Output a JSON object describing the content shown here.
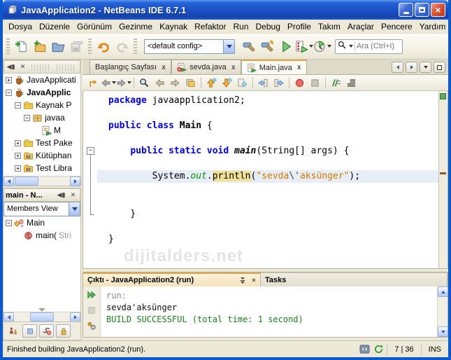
{
  "window": {
    "title": "JavaApplication2 - NetBeans IDE 6.7.1"
  },
  "menu_bar": {
    "items": [
      "Dosya",
      "Düzenle",
      "Görünüm",
      "Gezinme",
      "Kaynak",
      "Refaktor",
      "Run",
      "Debug",
      "Profile",
      "Takım",
      "Araçlar",
      "Pencere",
      "Yardım"
    ]
  },
  "toolbar": {
    "config_value": "<default config>",
    "search_placeholder": "Ara (Ctrl+I)",
    "group1": [
      {
        "icon": "new-file"
      },
      {
        "icon": "new-project"
      },
      {
        "icon": "open-project"
      },
      {
        "icon": "save-all",
        "disabled": true
      }
    ],
    "group2": [
      {
        "icon": "undo"
      },
      {
        "icon": "redo",
        "disabled": true
      }
    ],
    "group3": [
      {
        "icon": "build"
      },
      {
        "icon": "clean-build"
      }
    ],
    "group4": [
      {
        "icon": "run"
      },
      {
        "icon": "debug",
        "dropdown": true
      },
      {
        "icon": "profile",
        "dropdown": true
      }
    ]
  },
  "projects_panel": {
    "tree": [
      {
        "label": "JavaApplicati",
        "icon": "project",
        "exp": "closed",
        "depth": 0
      },
      {
        "label": "JavaApplic",
        "icon": "project",
        "exp": "open",
        "depth": 0,
        "bold": true
      },
      {
        "label": "Kaynak P",
        "icon": "folder",
        "exp": "open",
        "depth": 1
      },
      {
        "label": "javaa",
        "icon": "package",
        "exp": "open",
        "depth": 2
      },
      {
        "label": "M",
        "icon": "java-file",
        "depth": 3
      },
      {
        "label": "Test Pake",
        "icon": "folder",
        "exp": "closed",
        "depth": 1
      },
      {
        "label": "Kütüphan",
        "icon": "libraries",
        "exp": "closed",
        "depth": 1
      },
      {
        "label": "Test Libra",
        "icon": "libraries",
        "exp": "closed",
        "depth": 1
      }
    ]
  },
  "navigator_panel": {
    "title": "main - N...",
    "view_value": "Members View",
    "tree": [
      {
        "label": "Main",
        "icon": "class",
        "exp": "open",
        "depth": 0
      },
      {
        "label": "main(",
        "label_suffix": "Stri",
        "icon": "method",
        "depth": 1
      }
    ],
    "filters": [
      {
        "icon": "inherited-members",
        "plain": true
      },
      {
        "icon": "show-fields"
      },
      {
        "icon": "show-static-members"
      },
      {
        "icon": "show-non-public"
      }
    ]
  },
  "editor": {
    "tabs": [
      {
        "label": "Başlangıç Sayfası",
        "active": false,
        "close": "x"
      },
      {
        "label": "sevda.java",
        "icon": "java-error",
        "active": false,
        "close": "x"
      },
      {
        "label": "Main.java",
        "icon": "java-file",
        "active": true,
        "close": "x"
      }
    ],
    "toolbar_icons": [
      {
        "icon": "last-edit-location"
      },
      {
        "icon": "back",
        "disabled": true,
        "dropdown": true
      },
      {
        "icon": "forward",
        "disabled": true,
        "dropdown": true
      },
      {
        "sep": true
      },
      {
        "icon": "find"
      },
      {
        "icon": "find-previous"
      },
      {
        "icon": "find-next"
      },
      {
        "icon": "toggle-highlight"
      },
      {
        "sep": true
      },
      {
        "icon": "previous-bookmark"
      },
      {
        "icon": "next-bookmark"
      },
      {
        "icon": "toggle-bookmark"
      },
      {
        "sep": true
      },
      {
        "icon": "shift-line-left"
      },
      {
        "icon": "shift-line-right"
      },
      {
        "sep": true
      },
      {
        "icon": "record-macro"
      },
      {
        "icon": "run-macro",
        "disabled": true
      },
      {
        "sep": true
      },
      {
        "icon": "comment"
      },
      {
        "icon": "uncomment"
      }
    ],
    "watermark": "dijitalders.net",
    "code_lines": [
      {
        "seg": [
          [
            "kw",
            "package"
          ],
          [
            "pl",
            " javaapplication2;"
          ]
        ]
      },
      {
        "seg": []
      },
      {
        "seg": [
          [
            "kw",
            "public"
          ],
          [
            "pl",
            " "
          ],
          [
            "kw",
            "class"
          ],
          [
            "pl",
            " "
          ],
          [
            "cls",
            "Main"
          ],
          [
            "pl",
            " {"
          ]
        ]
      },
      {
        "seg": []
      },
      {
        "seg": [
          [
            "pl",
            "    "
          ],
          [
            "kw",
            "public"
          ],
          [
            "pl",
            " "
          ],
          [
            "kw",
            "static"
          ],
          [
            "pl",
            " "
          ],
          [
            "kw",
            "void"
          ],
          [
            "pl",
            " "
          ],
          [
            "mtd",
            "main"
          ],
          [
            "pl",
            "(String[] args) {"
          ]
        ]
      },
      {
        "seg": []
      },
      {
        "hl": true,
        "seg": [
          [
            "pl",
            "        System."
          ],
          [
            "fld",
            "out"
          ],
          [
            "pl",
            "."
          ],
          [
            "mark",
            "println"
          ],
          [
            "pl",
            "("
          ],
          [
            "str",
            "\"sevda"
          ],
          [
            "esc",
            "\\'"
          ],
          [
            "str",
            "aksünger\""
          ],
          [
            "pl",
            ");"
          ]
        ]
      },
      {
        "seg": []
      },
      {
        "seg": []
      },
      {
        "seg": [
          [
            "pl",
            "    }"
          ]
        ]
      },
      {
        "seg": []
      },
      {
        "seg": [
          [
            "pl",
            "}"
          ]
        ]
      }
    ]
  },
  "output_panel": {
    "tabs": [
      {
        "label": "Çıktı - JavaApplication2 (run)",
        "active": true
      },
      {
        "label": "Tasks",
        "active": false
      }
    ],
    "buttons": [
      {
        "icon": "rerun"
      },
      {
        "icon": "stop",
        "disabled": true
      },
      {
        "icon": "output-options"
      }
    ],
    "lines": [
      {
        "style": "muted",
        "text": "run:"
      },
      {
        "style": "plain",
        "text": "sevda'aksünger"
      },
      {
        "style": "success",
        "text": "BUILD SUCCESSFUL (total time: 1 second)"
      }
    ]
  },
  "status_bar": {
    "message": "Finished building JavaApplication2 (run).",
    "caret_position": "7 | 36",
    "insert_mode": "INS"
  },
  "colors": {
    "titlebar_blue": "#1A4FC4",
    "keyword": "#0000E6",
    "string_orange": "#CE7B00",
    "field_green": "#009900",
    "build_success_green": "#1E7D1E",
    "active_tab_accent": "#E8A33D",
    "current_line_highlight": "#E7EEF8",
    "occurrence_highlight": "#EFE193"
  }
}
